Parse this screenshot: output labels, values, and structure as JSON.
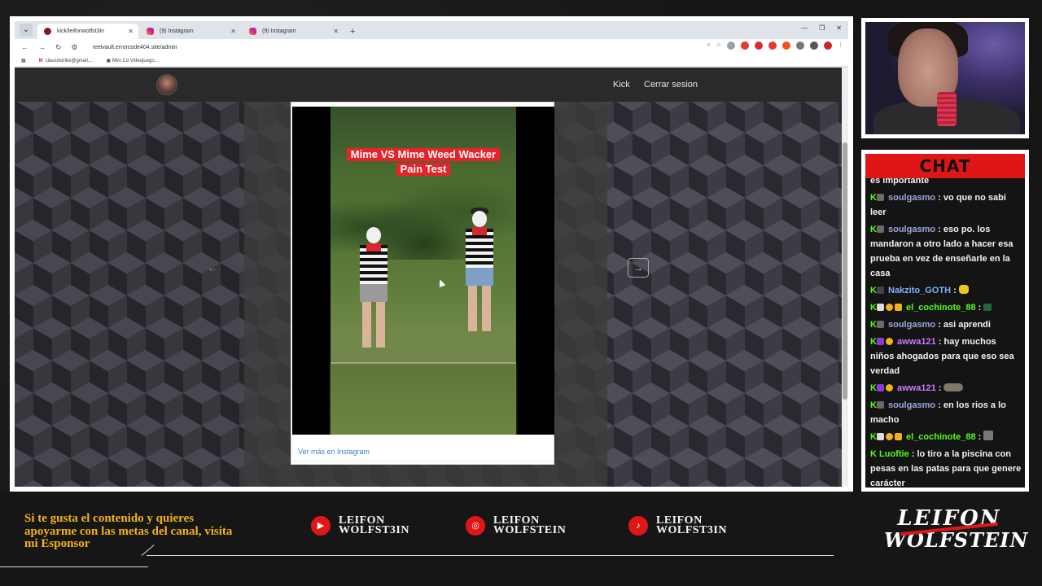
{
  "browser": {
    "tabs": [
      {
        "label": "kick/leifonwolfst3in",
        "favicon": "kick",
        "active": true
      },
      {
        "label": "(9) Instagram",
        "favicon": "instagram",
        "active": false
      },
      {
        "label": "(9) Instagram",
        "favicon": "instagram",
        "active": false
      }
    ],
    "url": "reelvault.errorcode404.site/admin",
    "bookmarks": [
      "clausdstrike@gmail....",
      "Mini Cd Videojuego..."
    ]
  },
  "site": {
    "nav_links": [
      "Kick",
      "Cerrar sesion"
    ]
  },
  "embed": {
    "caption_line1": "Mime VS Mime Weed Wacker",
    "caption_line2": "Pain Test",
    "link_text": "Ver más en Instagram"
  },
  "chat": {
    "title": "CHAT",
    "messages": [
      {
        "user": "",
        "text": "es importante",
        "color": "#f2f2f2",
        "continuation": true
      },
      {
        "user": "soulgasmo",
        "text": "vo que no sabi leer",
        "color": "#9aa8d8"
      },
      {
        "user": "soulgasmo",
        "text": "eso po. los mandaron a otro lado a hacer esa prueba en vez de enseñarle en la casa",
        "color": "#9aa8d8"
      },
      {
        "user": "Nakzito_GOTH",
        "text": "",
        "color": "#7fb0ff",
        "emote": "clap"
      },
      {
        "user": "el_cochinote_88",
        "text": "",
        "color": "#53fc18",
        "emote": "sign"
      },
      {
        "user": "soulgasmo",
        "text": "asi aprendi",
        "color": "#9aa8d8"
      },
      {
        "user": "awwa121",
        "text": "hay muchos niños ahogados para que eso sea verdad",
        "color": "#c77dff"
      },
      {
        "user": "awwa121",
        "text": "",
        "color": "#c77dff",
        "emote": "car"
      },
      {
        "user": "soulgasmo",
        "text": "en los rios a lo macho",
        "color": "#9aa8d8"
      },
      {
        "user": "el_cochinote_88",
        "text": "",
        "color": "#53fc18",
        "emote": "pic"
      },
      {
        "user": "Luoftie",
        "text": "lo tiro a la piscina con pesas en las patas para que genere carácter",
        "color": "#53fc18"
      }
    ]
  },
  "footer": {
    "sponsor_text": "Si te gusta el contenido y quieres apoyarme con las metas del canal, visita mi Esponsor",
    "socials": [
      {
        "platform": "youtube-icon",
        "line1": "LEIFON",
        "line2": "WOLFST3IN"
      },
      {
        "platform": "instagram-icon",
        "line1": "LEIFON",
        "line2": "WOLFSTEIN"
      },
      {
        "platform": "tiktok-icon",
        "line1": "LEIFON",
        "line2": "WOLFST3IN"
      }
    ],
    "brand_line1": "LEIFON",
    "brand_line2": "WOLFSTEIN"
  },
  "colors": {
    "accent_red": "#e01616",
    "kick_green": "#53fc18",
    "sponsor_gold": "#f2b318"
  }
}
